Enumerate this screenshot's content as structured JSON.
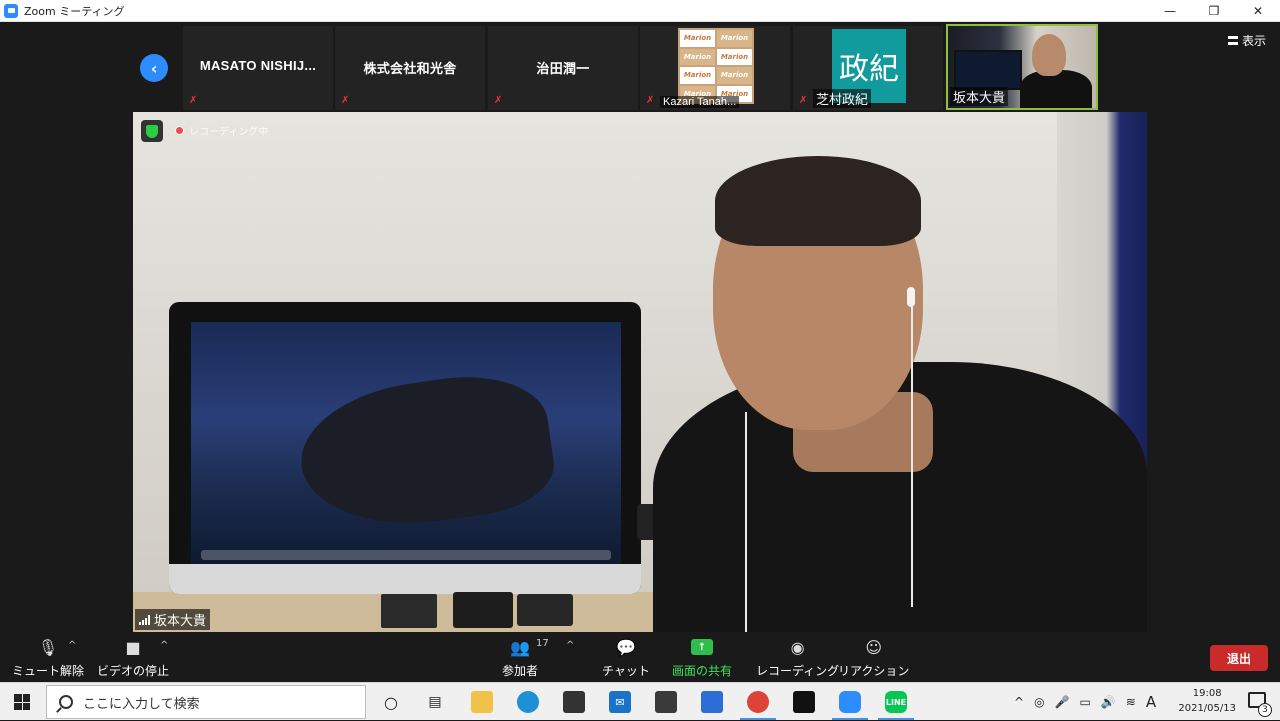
{
  "window": {
    "title": "Zoom ミーティング",
    "minimize_icon": "minimize-icon",
    "restore_icon": "restore-icon",
    "close_icon": "close-icon"
  },
  "view_button": {
    "label": "表示",
    "icon": "grid-view-icon"
  },
  "participants_strip": [
    {
      "name": "MASATO NISHIJ...",
      "muted": true
    },
    {
      "name": "株式会社和光舎",
      "muted": true
    },
    {
      "name": "治田潤一",
      "muted": true
    },
    {
      "name": "Kazari Tanah...",
      "muted": true,
      "avatar": "marion-logo",
      "logo_text": "Marion"
    },
    {
      "name": "芝村政紀",
      "muted": true,
      "avatar_text": "政紀",
      "avatar_color": "#129b9c"
    },
    {
      "name": "坂本大貴",
      "muted": false,
      "active_speaker": true,
      "highlight_color": "#8fbf3f"
    }
  ],
  "main_video": {
    "speaker_name": "坂本大貴",
    "recording_label": "レコーディング中",
    "security_icon": "shield-icon"
  },
  "toolbar": {
    "unmute": {
      "label": "ミュート解除",
      "icon": "muted-mic-icon"
    },
    "stop_video": {
      "label": "ビデオの停止",
      "icon": "video-camera-icon"
    },
    "participants": {
      "label": "参加者",
      "count": "17",
      "icon": "participants-icon"
    },
    "chat": {
      "label": "チャット",
      "icon": "chat-icon"
    },
    "share_screen": {
      "label": "画面の共有",
      "icon": "share-screen-icon",
      "color": "#3ce05a"
    },
    "record": {
      "label": "レコーディング",
      "icon": "record-icon"
    },
    "reactions": {
      "label": "リアクション",
      "icon": "reaction-icon"
    },
    "leave": {
      "label": "退出",
      "color": "#c92a2a"
    }
  },
  "taskbar": {
    "search_placeholder": "ここに入力して検索",
    "apps": [
      "cortana-icon",
      "task-view-icon",
      "file-explorer-icon",
      "edge-icon",
      "store-icon",
      "mail-icon",
      "app-icon",
      "teamviewer-icon",
      "chrome-icon",
      "app-icon-2",
      "zoom-icon",
      "line-icon"
    ],
    "tray_ime": "A",
    "time": "19:08",
    "date": "2021/05/13",
    "notification_count": "3"
  }
}
